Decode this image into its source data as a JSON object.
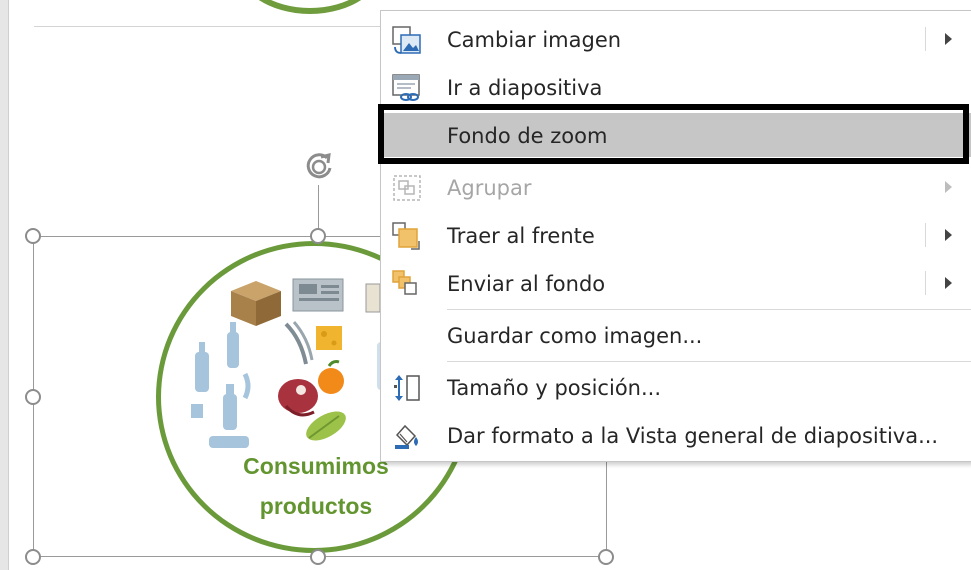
{
  "context_menu": {
    "items": [
      {
        "label": "Cambiar imagen",
        "icon": "change-picture-icon",
        "submenu": true,
        "enabled": true
      },
      {
        "label": "Ir a diapositiva",
        "icon": "go-to-slide-icon",
        "submenu": false,
        "enabled": true
      },
      {
        "label": "Fondo de zoom",
        "icon": "",
        "submenu": false,
        "enabled": true,
        "highlighted": true
      },
      {
        "label": "Agrupar",
        "icon": "group-icon",
        "submenu": true,
        "enabled": false
      },
      {
        "label": "Traer al frente",
        "icon": "bring-to-front-icon",
        "submenu": true,
        "enabled": true
      },
      {
        "label": "Enviar al fondo",
        "icon": "send-to-back-icon",
        "submenu": true,
        "enabled": true
      },
      {
        "label": "Guardar como imagen...",
        "icon": "",
        "submenu": false,
        "enabled": true
      },
      {
        "label": "Tamaño y posición...",
        "icon": "size-position-icon",
        "submenu": false,
        "enabled": true
      },
      {
        "label": "Dar formato a la Vista general de diapositiva...",
        "icon": "format-icon",
        "submenu": false,
        "enabled": true
      }
    ]
  },
  "zoom_object": {
    "label_line1": "Consumimos",
    "label_line2": "productos"
  },
  "colors": {
    "accent_green": "#6a9a3a",
    "highlight": "#c6c6c6",
    "highlight_frame": "#000000"
  }
}
